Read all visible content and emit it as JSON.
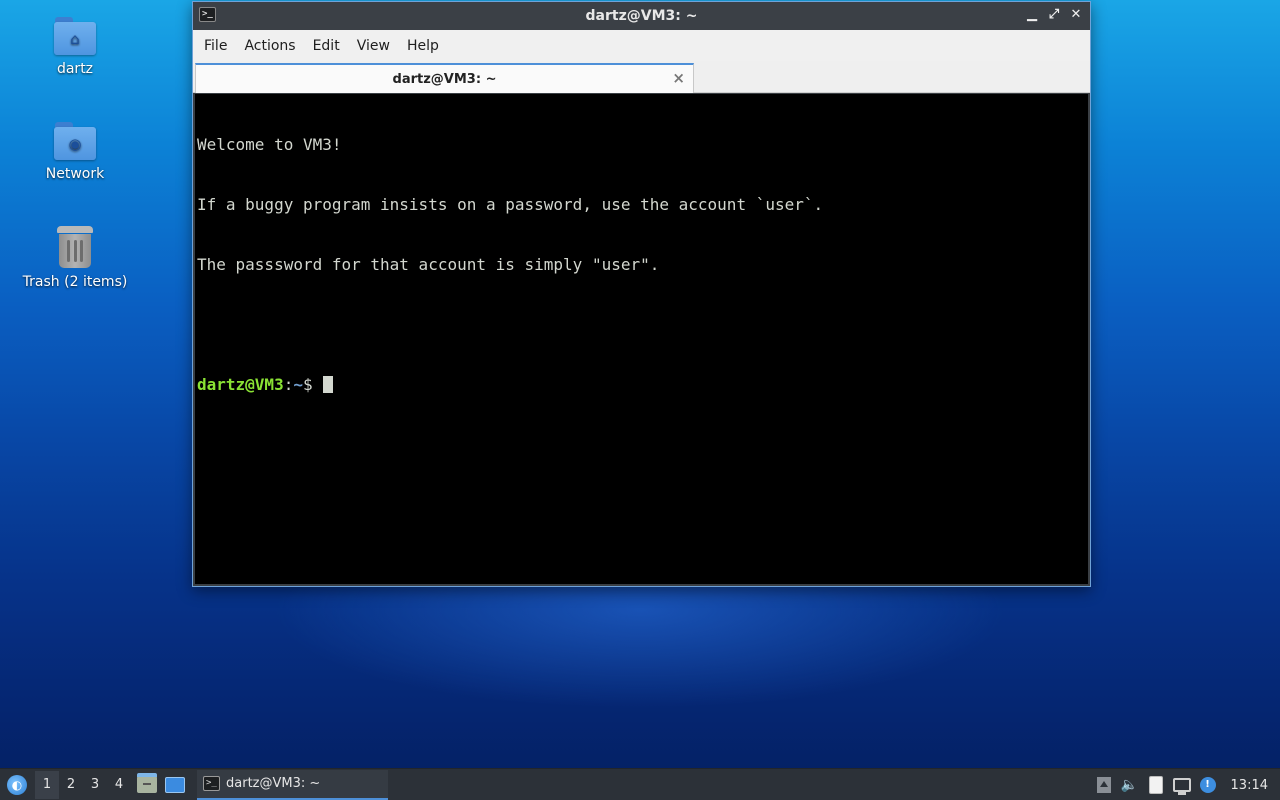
{
  "desktop": {
    "icons": [
      {
        "label": "dartz",
        "icon": "home-folder-icon"
      },
      {
        "label": "Network",
        "icon": "network-folder-icon"
      },
      {
        "label": "Trash (2 items)",
        "icon": "trash-icon"
      }
    ]
  },
  "window": {
    "title": "dartz@VM3: ~",
    "controls": {
      "minimize": "▁",
      "maximize": "⤢",
      "close": "✕"
    },
    "menu": [
      "File",
      "Actions",
      "Edit",
      "View",
      "Help"
    ],
    "tab": {
      "label": "dartz@VM3: ~",
      "close": "×"
    },
    "terminal": {
      "lines": [
        "Welcome to VM3!",
        "If a buggy program insists on a password, use the account `user`.",
        "The passsword for that account is simply \"user\"."
      ],
      "prompt_user": "dartz@VM3",
      "prompt_sep": ":",
      "prompt_path": "~",
      "prompt_symbol": "$ "
    }
  },
  "taskbar": {
    "workspaces": [
      "1",
      "2",
      "3",
      "4"
    ],
    "active_workspace": "1",
    "task_label": "dartz@VM3: ~",
    "clock": "13:14"
  },
  "colors": {
    "accent": "#4d8fd8",
    "prompt_user": "#8ae234",
    "prompt_path": "#729fcf",
    "terminal_bg": "#000000",
    "terminal_fg": "#d3d7cf"
  }
}
